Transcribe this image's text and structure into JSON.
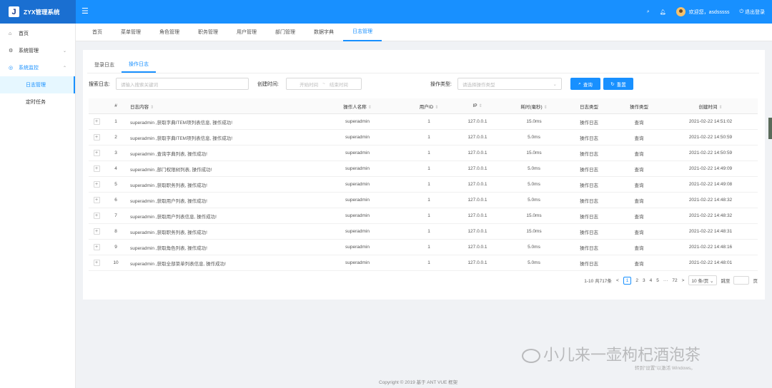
{
  "app": {
    "logo_letter": "J",
    "title": "ZYX管理系统",
    "menu_icon": "menu-fold-icon"
  },
  "header": {
    "welcome": "欢迎您，asdsssss",
    "logout": "退出登录",
    "icons": [
      "search-icon",
      "bell-icon"
    ]
  },
  "sidebar": {
    "items": [
      {
        "label": "首页",
        "icon": "home-icon"
      },
      {
        "label": "系统管理",
        "icon": "setting-icon"
      },
      {
        "label": "系统监控",
        "icon": "monitor-icon"
      }
    ],
    "sub": [
      "日志管理",
      "定时任务"
    ]
  },
  "tabs": [
    "首页",
    "菜单管理",
    "角色管理",
    "职务管理",
    "用户管理",
    "部门管理",
    "数据字典",
    "日志管理"
  ],
  "inner_tabs": [
    "登录日志",
    "操作日志"
  ],
  "search": {
    "log_label": "搜索日志:",
    "log_placeholder": "请输入搜索关键词",
    "ctime_label": "创建时间:",
    "start_placeholder": "开始时间",
    "sep": "~",
    "end_placeholder": "结束时间",
    "optype_label": "操作类型:",
    "optype_placeholder": "请选择操作类型",
    "query": "查询",
    "reset": "重置"
  },
  "table": {
    "headers": [
      "#",
      "日志内容",
      "操作人名称",
      "用户ID",
      "IP",
      "耗时(毫秒)",
      "日志类型",
      "操作类型",
      "创建时间"
    ],
    "rows": [
      [
        "1",
        "superadmin ,获取字典ITEM项列表信息, 操作成功!",
        "superadmin",
        "1",
        "127.0.0.1",
        "15.0ms",
        "操作日志",
        "查询",
        "2021-02-22 14:51:02"
      ],
      [
        "2",
        "superadmin ,获取字典ITEM项列表信息, 操作成功!",
        "superadmin",
        "1",
        "127.0.0.1",
        "5.0ms",
        "操作日志",
        "查询",
        "2021-02-22 14:50:59"
      ],
      [
        "3",
        "superadmin ,查询字典列表, 操作成功!",
        "superadmin",
        "1",
        "127.0.0.1",
        "15.0ms",
        "操作日志",
        "查询",
        "2021-02-22 14:50:59"
      ],
      [
        "4",
        "superadmin ,部门权限树列表, 操作成功!",
        "superadmin",
        "1",
        "127.0.0.1",
        "5.0ms",
        "操作日志",
        "查询",
        "2021-02-22 14:49:09"
      ],
      [
        "5",
        "superadmin ,获取职务列表, 操作成功!",
        "superadmin",
        "1",
        "127.0.0.1",
        "5.0ms",
        "操作日志",
        "查询",
        "2021-02-22 14:49:08"
      ],
      [
        "6",
        "superadmin ,获取用户列表, 操作成功!",
        "superadmin",
        "1",
        "127.0.0.1",
        "5.0ms",
        "操作日志",
        "查询",
        "2021-02-22 14:48:32"
      ],
      [
        "7",
        "superadmin ,获取用户列表信息, 操作成功!",
        "superadmin",
        "1",
        "127.0.0.1",
        "15.0ms",
        "操作日志",
        "查询",
        "2021-02-22 14:48:32"
      ],
      [
        "8",
        "superadmin ,获取职务列表, 操作成功!",
        "superadmin",
        "1",
        "127.0.0.1",
        "15.0ms",
        "操作日志",
        "查询",
        "2021-02-22 14:48:31"
      ],
      [
        "9",
        "superadmin ,获取角色列表, 操作成功!",
        "superadmin",
        "1",
        "127.0.0.1",
        "5.0ms",
        "操作日志",
        "查询",
        "2021-02-22 14:48:16"
      ],
      [
        "10",
        "superadmin ,获取全部菜单列表信息, 操作成功!",
        "superadmin",
        "1",
        "127.0.0.1",
        "5.0ms",
        "操作日志",
        "查询",
        "2021-02-22 14:48:01"
      ]
    ]
  },
  "pagination": {
    "total_text": "1-10 共717条",
    "prev": "<",
    "pages": [
      "1",
      "2",
      "3",
      "4",
      "5"
    ],
    "ellipsis": "···",
    "last": "72",
    "next": ">",
    "page_size": "10 条/页",
    "jump_label": "跳至",
    "page_unit": "页"
  },
  "footer": "Copyright © 2019 基于 ANT VUE 框架",
  "watermark": "小儿来一壶枸杞酒泡茶",
  "windows_hint": "转到\"设置\"以激活 Windows。",
  "colors": {
    "primary": "#1890ff",
    "logo_bg": "#1a6fd1",
    "active_bg": "#e6f7ff"
  }
}
